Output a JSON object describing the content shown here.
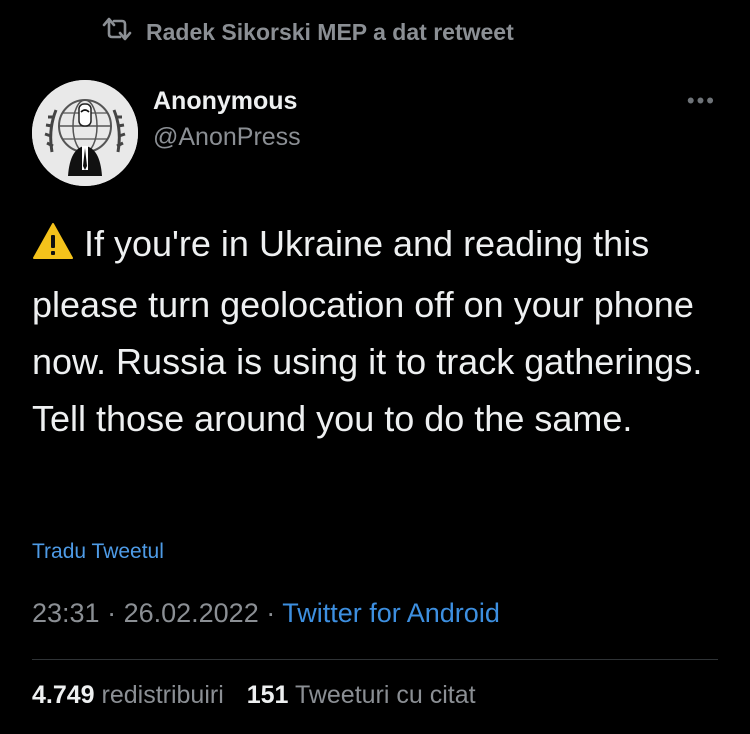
{
  "retweet": {
    "text": "Radek Sikorski MEP a dat retweet",
    "icon": "retweet-icon"
  },
  "author": {
    "name": "Anonymous",
    "handle": "@AnonPress",
    "avatar_icon": "anonymous-logo"
  },
  "more_label": "•••",
  "tweet": {
    "emoji": "warning-icon",
    "text": "If you're in Ukraine and reading this please turn geolocation off on your phone now. Russia is using it to track gatherings. Tell those around you to do the same."
  },
  "translate_label": "Tradu Tweetul",
  "meta": {
    "time": "23:31",
    "separator": " · ",
    "date": "26.02.2022",
    "source": "Twitter for Android"
  },
  "stats": {
    "retweets_count": "4.749",
    "retweets_label": "redistribuiri",
    "quotes_count": "151",
    "quotes_label": "Tweeturi cu citat"
  },
  "colors": {
    "background": "#000000",
    "link": "#3d8fe0",
    "muted": "#8b8f94",
    "divider": "#2f3336"
  }
}
